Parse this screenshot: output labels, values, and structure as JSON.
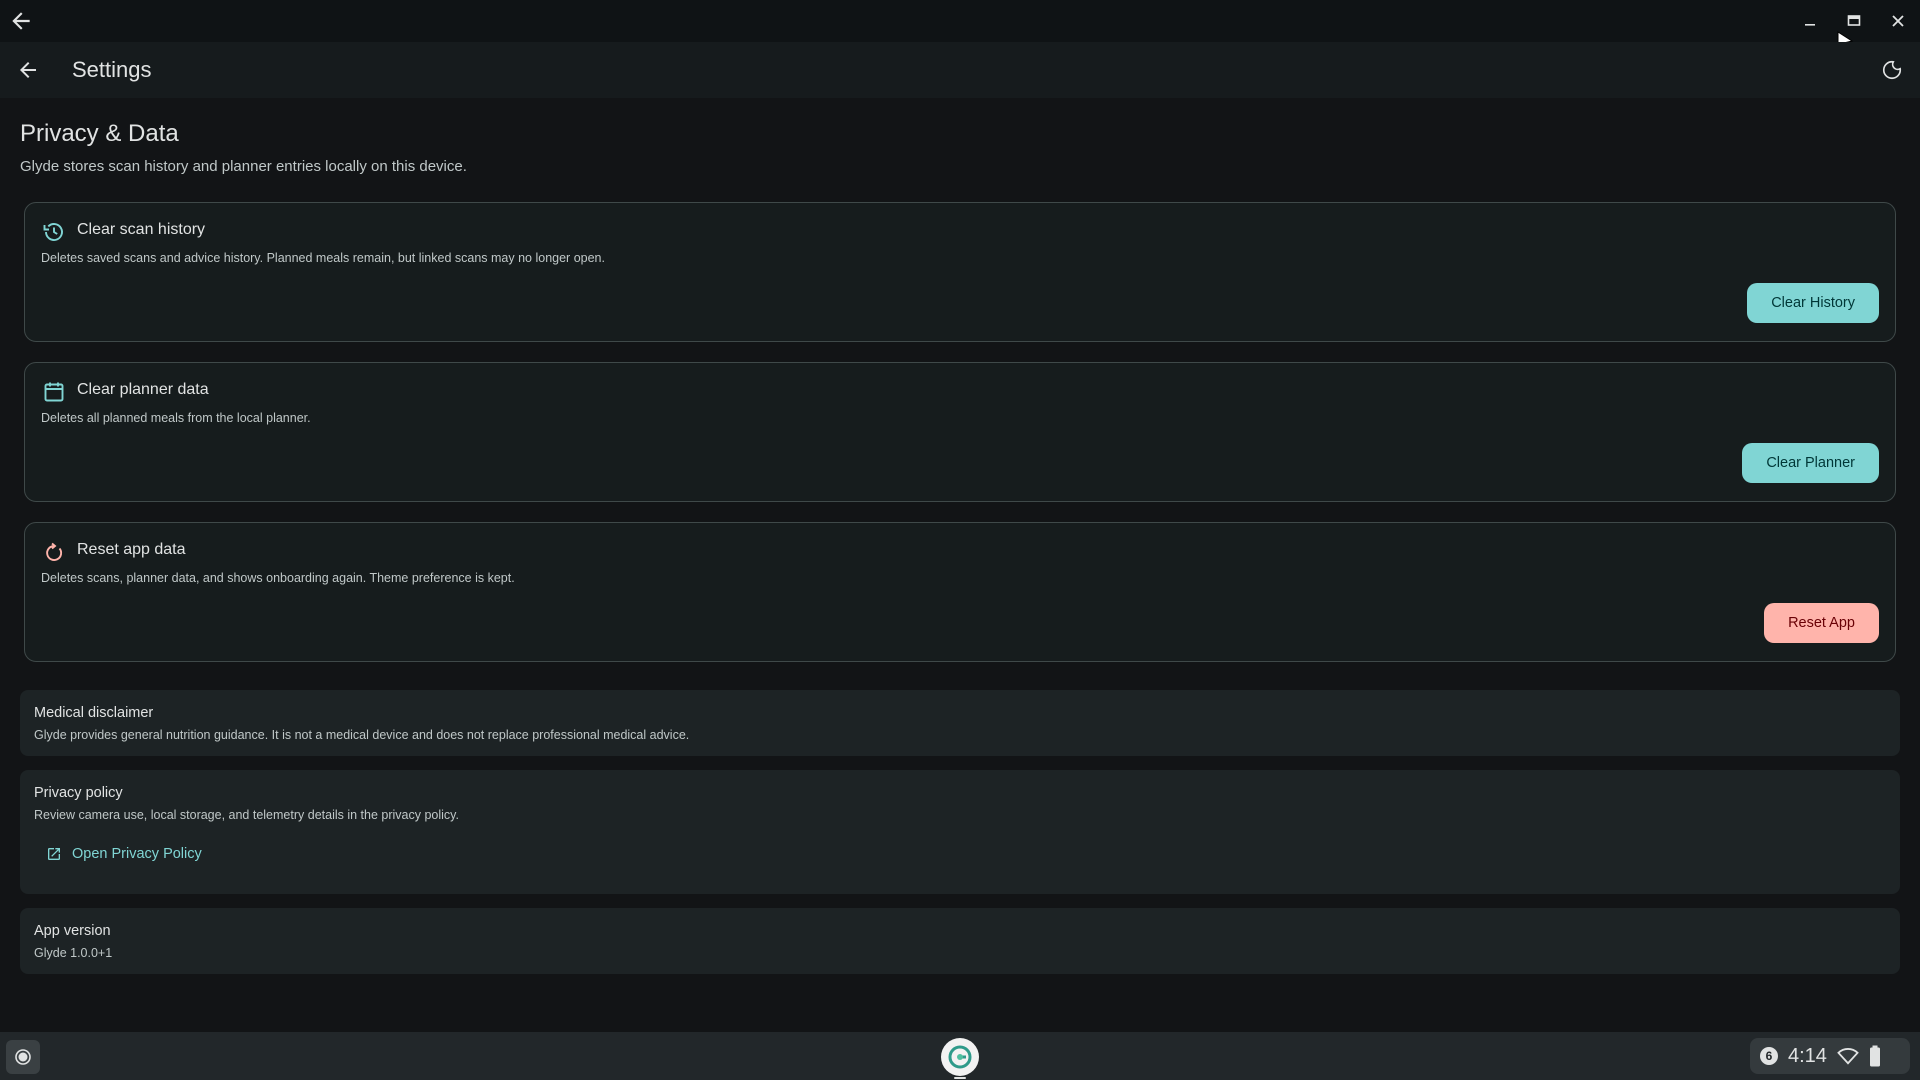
{
  "appbar": {
    "title": "Settings"
  },
  "section": {
    "title": "Privacy & Data",
    "subtitle": "Glyde stores scan history and planner entries locally on this device."
  },
  "cards": [
    {
      "icon": "history-icon",
      "title": "Clear scan history",
      "description": "Deletes saved scans and advice history. Planned meals remain, but linked scans may no longer open.",
      "button": "Clear History"
    },
    {
      "icon": "calendar-icon",
      "title": "Clear planner data",
      "description": "Deletes all planned meals from the local planner.",
      "button": "Clear Planner"
    },
    {
      "icon": "reset-icon",
      "title": "Reset app data",
      "description": "Deletes scans, planner data, and shows onboarding again. Theme preference is kept.",
      "button": "Reset App"
    }
  ],
  "medical": {
    "title": "Medical disclaimer",
    "description": "Glyde provides general nutrition guidance. It is not a medical device and does not replace professional medical advice."
  },
  "privacy": {
    "title": "Privacy policy",
    "description": "Review camera use, local storage, and telemetry details in the privacy policy.",
    "link": "Open Privacy Policy"
  },
  "version": {
    "title": "App version",
    "value": "Glyde 1.0.0+1"
  },
  "taskbar": {
    "notification_count": "6",
    "time": "4:14"
  },
  "colors": {
    "accent": "#80d5d4",
    "danger": "#ffb4ab",
    "background": "#121416"
  }
}
